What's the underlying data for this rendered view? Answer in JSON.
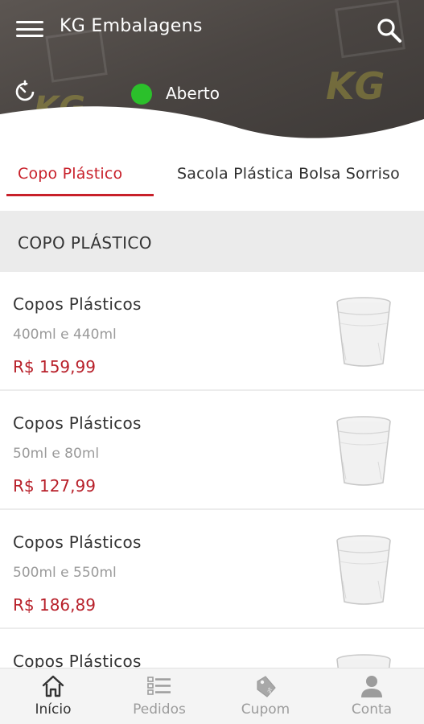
{
  "header": {
    "title": "KG Embalagens",
    "status": "Aberto",
    "status_color": "#2bc02b",
    "menu_icon": "hamburger-menu-icon",
    "search_icon": "search-icon",
    "clock_icon": "timer-icon"
  },
  "tabs": [
    {
      "label": "Copo Plástico",
      "active": true
    },
    {
      "label": "Sacola Plástica Bolsa Sorriso",
      "active": false
    }
  ],
  "section": {
    "title": "COPO PLÁSTICO"
  },
  "products": [
    {
      "name": "Copos Plásticos",
      "desc": "400ml e 440ml",
      "price": "R$ 159,99"
    },
    {
      "name": "Copos Plásticos",
      "desc": "50ml e 80ml",
      "price": "R$ 127,99"
    },
    {
      "name": "Copos Plásticos",
      "desc": "500ml e 550ml",
      "price": "R$ 186,89"
    },
    {
      "name": "Copos Plásticos",
      "desc": "",
      "price": ""
    }
  ],
  "bottom_nav": [
    {
      "label": "Início",
      "icon": "home-icon",
      "active": true
    },
    {
      "label": "Pedidos",
      "icon": "order-list-icon",
      "active": false
    },
    {
      "label": "Cupom",
      "icon": "coupon-tag-icon",
      "active": false
    },
    {
      "label": "Conta",
      "icon": "user-icon",
      "active": false
    }
  ],
  "colors": {
    "accent": "#c8202a",
    "price": "#b8202a",
    "header_bg": "#4a4542"
  }
}
